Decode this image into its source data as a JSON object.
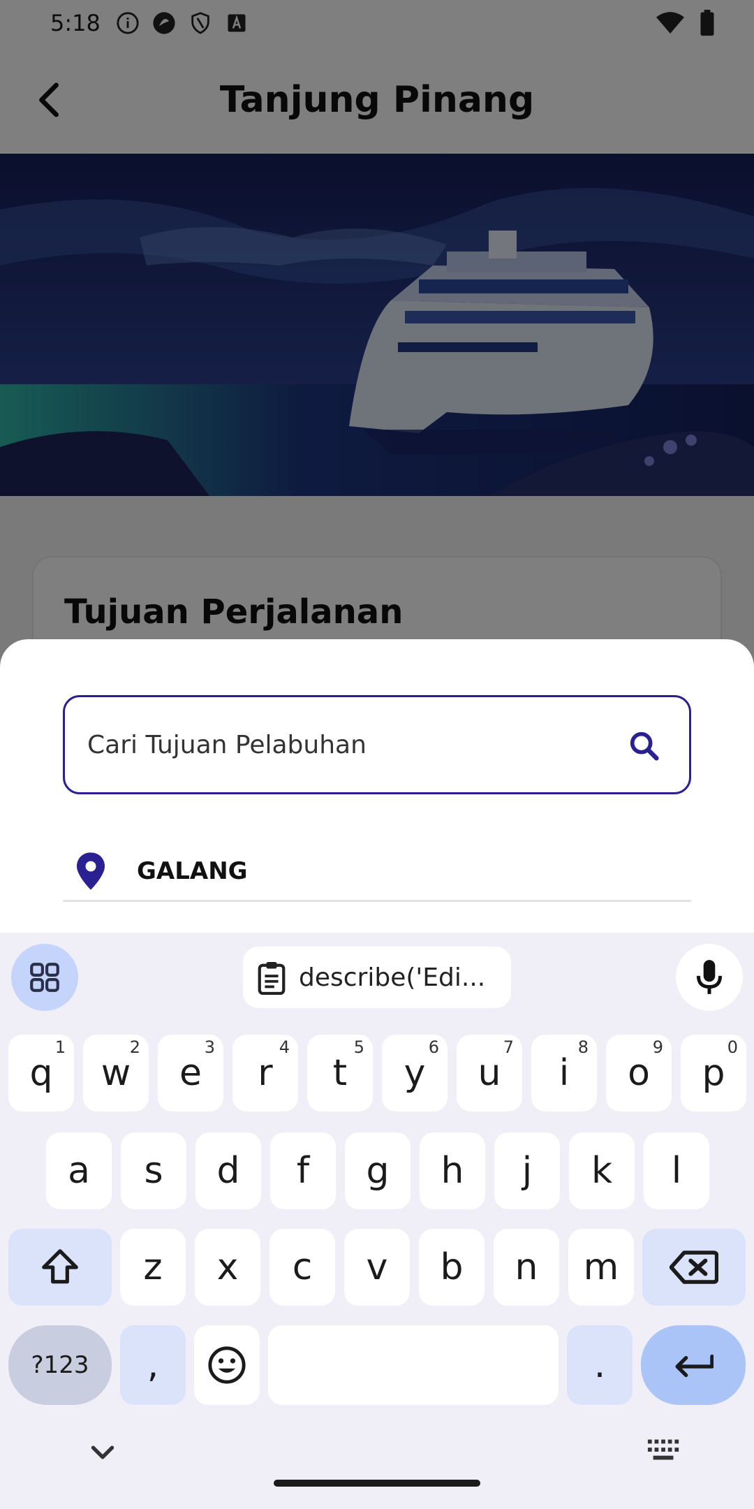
{
  "status_bar": {
    "time": "5:18"
  },
  "app_bar": {
    "title": "Tanjung Pinang"
  },
  "card": {
    "title": "Tujuan Perjalanan"
  },
  "sheet": {
    "search": {
      "placeholder": "Cari Tujuan Pelabuhan"
    },
    "results": [
      {
        "label": "GALANG"
      }
    ]
  },
  "keyboard": {
    "clipboard_suggestion": "describe('Edi...",
    "row1": [
      {
        "k": "q",
        "h": "1"
      },
      {
        "k": "w",
        "h": "2"
      },
      {
        "k": "e",
        "h": "3"
      },
      {
        "k": "r",
        "h": "4"
      },
      {
        "k": "t",
        "h": "5"
      },
      {
        "k": "y",
        "h": "6"
      },
      {
        "k": "u",
        "h": "7"
      },
      {
        "k": "i",
        "h": "8"
      },
      {
        "k": "o",
        "h": "9"
      },
      {
        "k": "p",
        "h": "0"
      }
    ],
    "row2": [
      "a",
      "s",
      "d",
      "f",
      "g",
      "h",
      "j",
      "k",
      "l"
    ],
    "row3": [
      "z",
      "x",
      "c",
      "v",
      "b",
      "n",
      "m"
    ],
    "symbols_label": "?123",
    "comma_label": ",",
    "period_label": "."
  },
  "colors": {
    "accent": "#2a2091",
    "key_mod": "#dbe3fb",
    "enter": "#aac4f8"
  }
}
